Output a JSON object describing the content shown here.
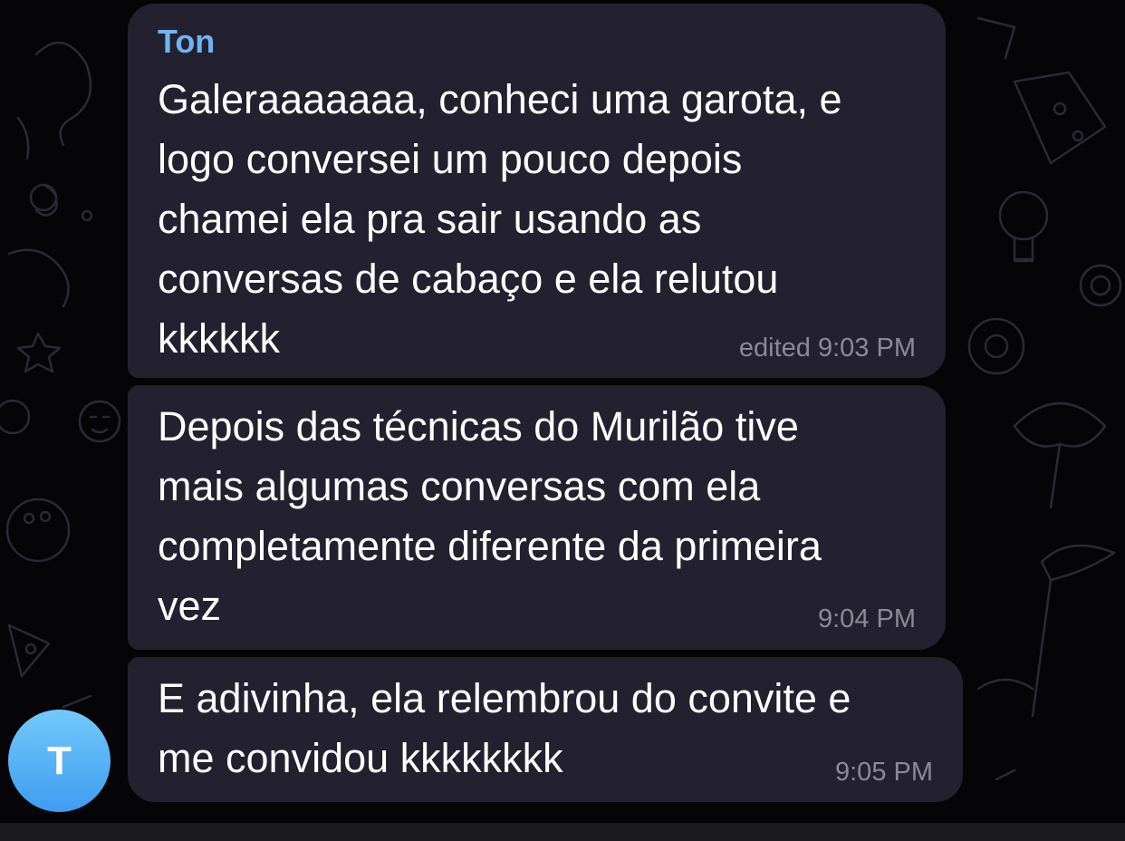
{
  "chat": {
    "sender_name": "Ton",
    "avatar_initial": "T",
    "messages": [
      {
        "text": "Galeraaaaaaa, conheci uma garota, e\nlogo conversei um pouco depois\nchamei ela pra sair usando as\nconversas de cabaço e ela relutou\nkkkkkk",
        "meta": "edited 9:03 PM"
      },
      {
        "text": "Depois das técnicas do Murilão tive\nmais algumas conversas com ela\ncompletamente diferente da primeira\nvez",
        "meta": "9:04 PM"
      },
      {
        "text": "E adivinha, ela relembrou do convite e\nme convidou kkkkkkkk",
        "meta": "9:05 PM"
      }
    ]
  },
  "colors": {
    "background": "#050507",
    "bubble": "#23202f",
    "sender_name": "#6fb4f2",
    "message_text": "#ffffff",
    "timestamp": "#8b8a96",
    "avatar_top": "#73c9fb",
    "avatar_bottom": "#3f9cf0"
  },
  "icons": {
    "background_pattern": "chat-doodle-wallpaper"
  }
}
